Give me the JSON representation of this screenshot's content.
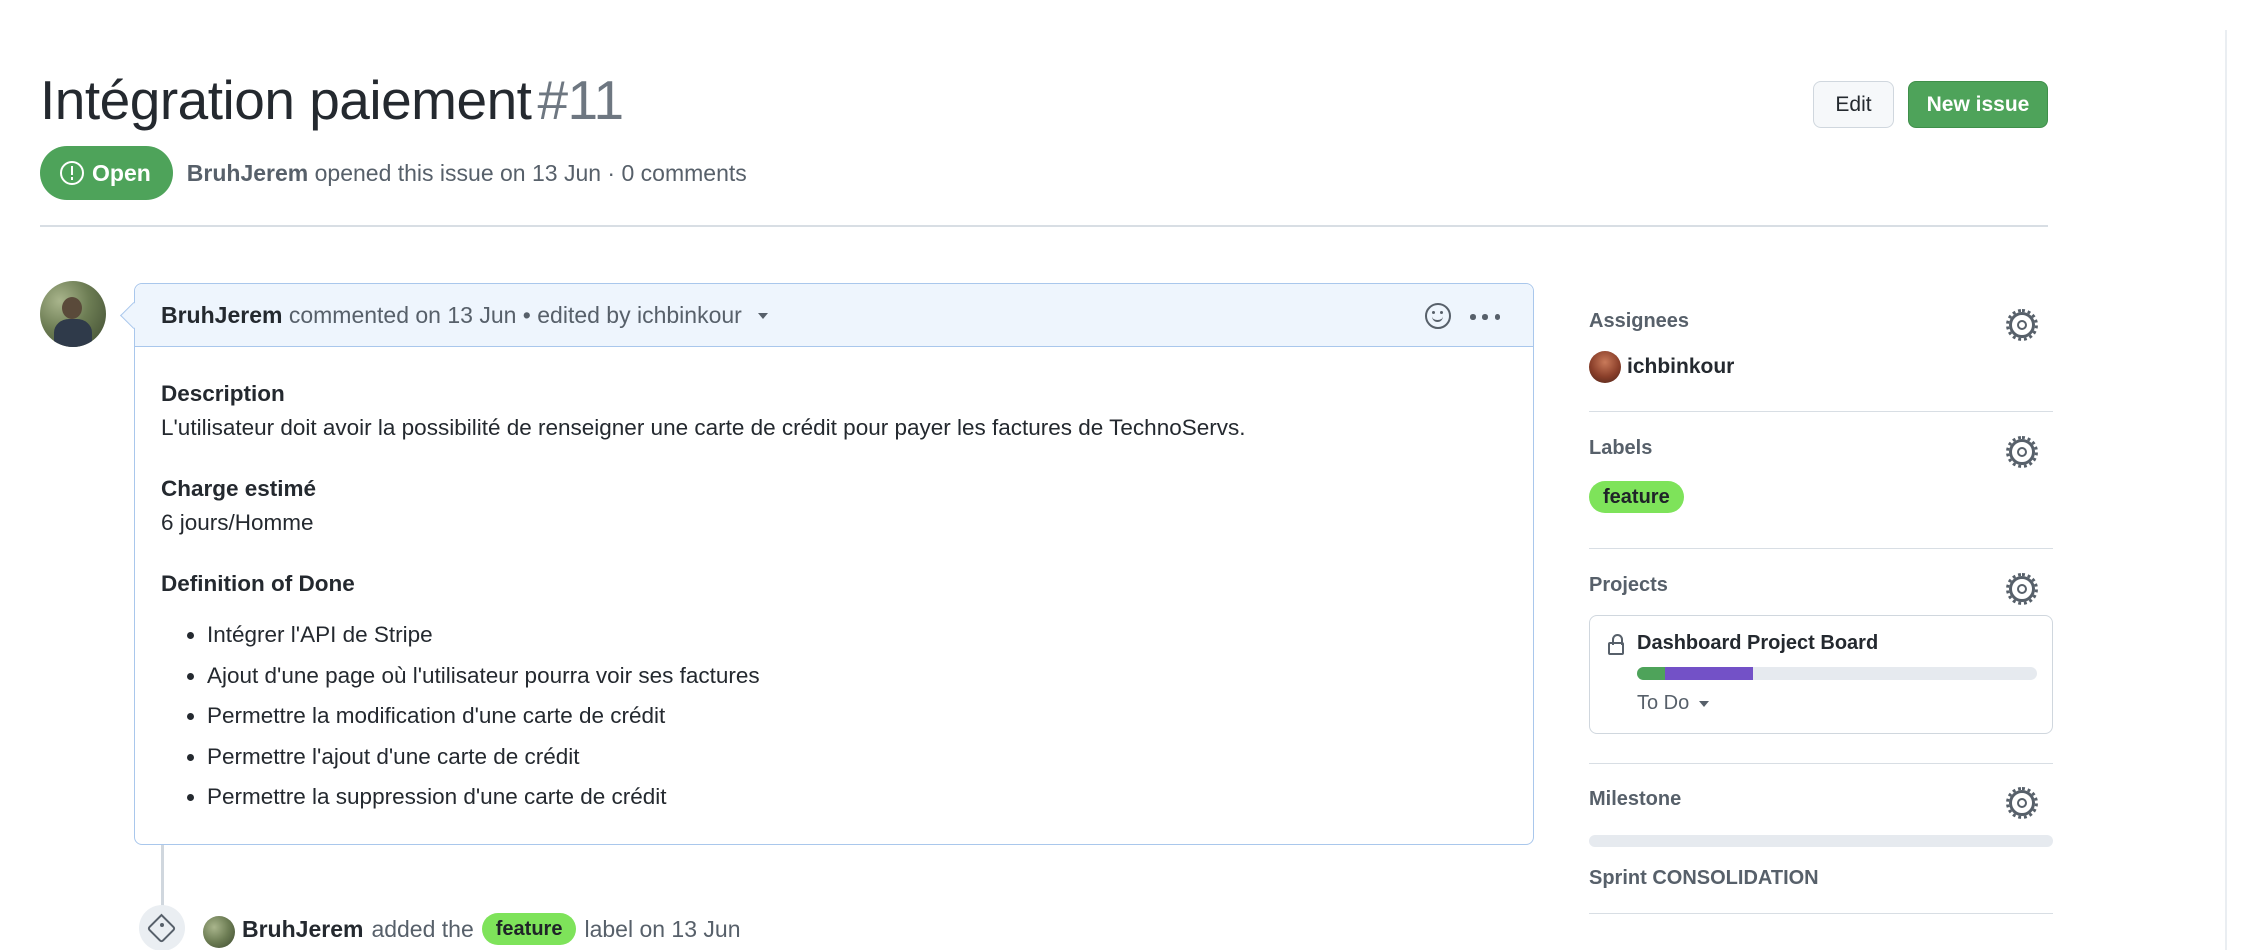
{
  "issue": {
    "title": "Intégration paiement",
    "number": "#11",
    "state": "Open",
    "author": "BruhJerem",
    "opened_text": "opened this issue on 13 Jun · 0 comments"
  },
  "header_actions": {
    "edit_label": "Edit",
    "new_issue_label": "New issue"
  },
  "comment": {
    "author": "BruhJerem",
    "meta": "commented on 13 Jun • edited by ichbinkour",
    "description_heading": "Description",
    "description_text": "L'utilisateur doit avoir la possibilité de renseigner une carte de crédit pour payer les factures de TechnoServs.",
    "charge_heading": "Charge estimé",
    "charge_text": "6 jours/Homme",
    "dod_heading": "Definition of Done",
    "dod_items": [
      "Intégrer l'API de Stripe",
      "Ajout d'une page où l'utilisateur pourra voir ses factures",
      "Permettre la modification d'une carte de crédit",
      "Permettre l'ajout d'une carte de crédit",
      "Permettre la suppression d'une carte de crédit"
    ]
  },
  "timeline_event": {
    "author": "BruhJerem",
    "text_before": "added the",
    "label": "feature",
    "text_after": "label on 13 Jun"
  },
  "sidebar": {
    "assignees_title": "Assignees",
    "assignee_name": "ichbinkour",
    "labels_title": "Labels",
    "label_name": "feature",
    "projects_title": "Projects",
    "project_name": "Dashboard Project Board",
    "project_status": "To Do",
    "project_progress": {
      "done_fraction": 0.07,
      "in_progress_fraction": 0.22
    },
    "milestone_title": "Milestone",
    "milestone_name": "Sprint CONSOLIDATION",
    "milestone_progress": 0
  },
  "colors": {
    "open_green": "#4ea35a",
    "label_feature": "#7ee35a",
    "project_purple": "#7351c7",
    "comment_border": "#a9c7ec"
  },
  "icons": [
    "issue-open-icon",
    "smiley-icon",
    "kebab-horizontal-icon",
    "tag-icon",
    "gear-icon",
    "lock-icon",
    "triangle-down-icon"
  ]
}
